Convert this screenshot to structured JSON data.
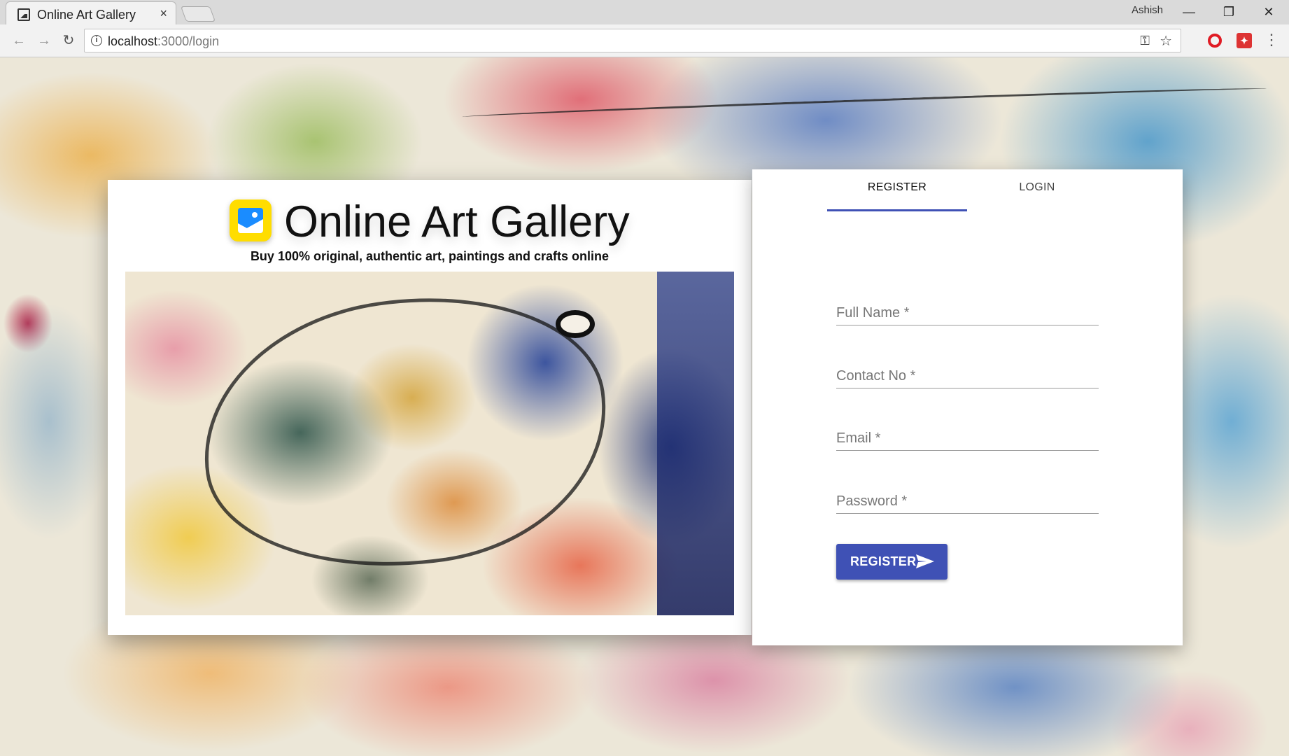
{
  "browser": {
    "tab_title": "Online Art Gallery",
    "tab_close": "×",
    "url_host": "localhost",
    "url_path": ":3000/login",
    "profile_name": "Ashish",
    "win_min": "—",
    "win_max": "❐",
    "win_close": "✕",
    "back": "←",
    "forward": "→",
    "reload": "↻",
    "key": "⚿",
    "star": "☆",
    "menu": "⋮"
  },
  "hero": {
    "title": "Online Art Gallery",
    "subtitle": "Buy 100% original, authentic art, paintings and crafts online"
  },
  "form": {
    "tabs": [
      {
        "label": "REGISTER",
        "active": true
      },
      {
        "label": "LOGIN",
        "active": false
      }
    ],
    "fields": [
      {
        "label": "Full Name *",
        "value": ""
      },
      {
        "label": "Contact No *",
        "value": ""
      },
      {
        "label": "Email *",
        "value": ""
      },
      {
        "label": "Password *",
        "value": ""
      }
    ],
    "submit_label": "REGISTER"
  },
  "colors": {
    "accent": "#3f51b5",
    "logo_badge": "#ffdd00",
    "logo_inner": "#1a8cff"
  }
}
